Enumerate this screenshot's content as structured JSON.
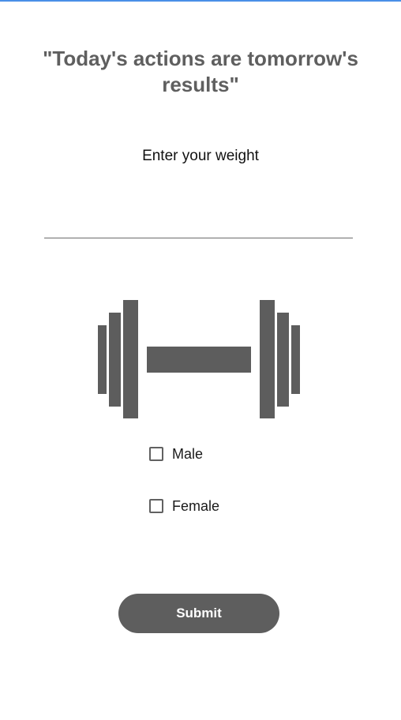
{
  "header": {
    "quote": "\"Today's actions are tomorrow's results\""
  },
  "weight": {
    "label": "Enter your weight",
    "value": "",
    "placeholder": ""
  },
  "illustration": {
    "icon": "dumbbell-icon",
    "color": "#5d5d5d"
  },
  "gender": {
    "options": [
      {
        "label": "Male",
        "checked": false
      },
      {
        "label": "Female",
        "checked": false
      }
    ]
  },
  "actions": {
    "submit_label": "Submit"
  },
  "colors": {
    "accent": "#4a8fe7",
    "primary_gray": "#5e5e5e",
    "text": "#111111"
  }
}
